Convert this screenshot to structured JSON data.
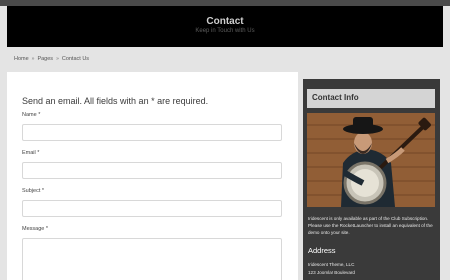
{
  "header": {
    "title": "Contact",
    "subtitle": "Keep in Touch with Us"
  },
  "breadcrumb": {
    "items": [
      "Home",
      "Pages",
      "Contact Us"
    ],
    "separator_icon": "double-chevron-right"
  },
  "form": {
    "heading": "Send an email. All fields with an * are required.",
    "name_label": "Name *",
    "name_value": "",
    "email_label": "Email *",
    "email_value": "",
    "subject_label": "Subject *",
    "subject_value": "",
    "message_label": "Message *",
    "message_value": ""
  },
  "sidebar": {
    "title": "Contact Info",
    "image_subject": "banjo-player",
    "description": "Iridescent is only available as part of the Club Subscription. Please use the RocketLauncher to install an equivalent of the demo onto your site.",
    "address_heading": "Address",
    "address_lines": [
      "Iridescent Theme, LLC",
      "123 Joomla! Boulevard"
    ]
  },
  "colors": {
    "hero_bg": "#000000",
    "top_bar": "#4a4a4a",
    "page_bg": "#e4e4e4",
    "sidebar_bg": "#3a3a3a",
    "sidebar_title_bg": "#d4d4d4"
  }
}
